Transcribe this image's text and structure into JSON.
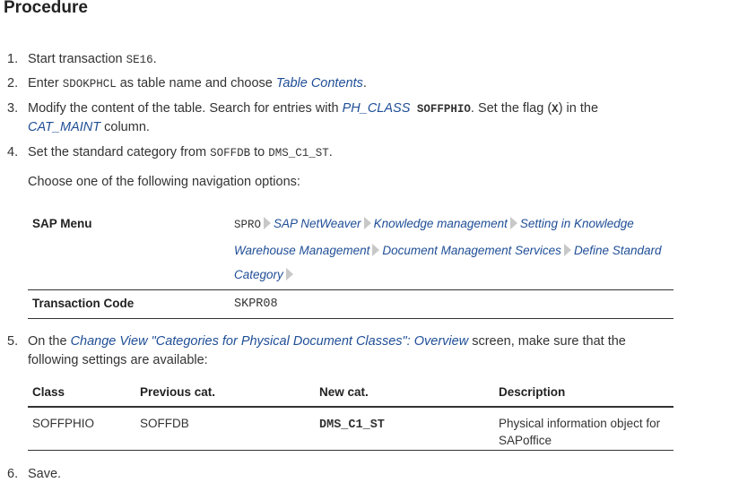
{
  "title": "Procedure",
  "steps": {
    "s1": {
      "num": "1.",
      "text": "Start transaction ",
      "code": "SE16",
      "end": "."
    },
    "s2": {
      "num": "2.",
      "pre": "Enter ",
      "code": "SDOKPHCL",
      "mid": " as table name and choose ",
      "link": "Table Contents",
      "end": "."
    },
    "s3": {
      "num": "3.",
      "pre": "Modify the content of the table. Search for entries with ",
      "link1": "PH_CLASS",
      "code1": " SOFFPHIO",
      "mid": ". Set the flag (",
      "code2": "X",
      "mid2": ") in the",
      "link2": "CAT_MAINT",
      "end": " column."
    },
    "s4": {
      "num": "4.",
      "pre": "Set the standard category from ",
      "code1": "SOFFDB",
      "mid": " to ",
      "code2": "DMS_C1_ST",
      "end": ".",
      "nav_intro": "Choose one of the following navigation options:"
    },
    "s5": {
      "num": "5.",
      "pre": "On the ",
      "link": "Change View \"Categories for Physical Document Classes\": Overview",
      "mid": " screen, make sure that the",
      "line2": "following settings are available:"
    },
    "s6": {
      "num": "6.",
      "text": "Save."
    }
  },
  "nav_table": {
    "menu_label": "SAP Menu",
    "path_start": "SPRO",
    "path_items": [
      "SAP NetWeaver",
      "Knowledge management",
      "Setting in Knowledge",
      "Warehouse Management",
      "Document Management Services",
      "Define Standard",
      "Category"
    ],
    "tcode_label": "Transaction Code",
    "tcode": "SKPR08"
  },
  "settings_table": {
    "headers": [
      "Class",
      "Previous cat.",
      "New cat.",
      "Description"
    ],
    "row": {
      "class": "SOFFPHIO",
      "previous": "SOFFDB",
      "new": "DMS_C1_ST",
      "desc1": "Physical information object for",
      "desc2": "SAPoffice"
    }
  }
}
